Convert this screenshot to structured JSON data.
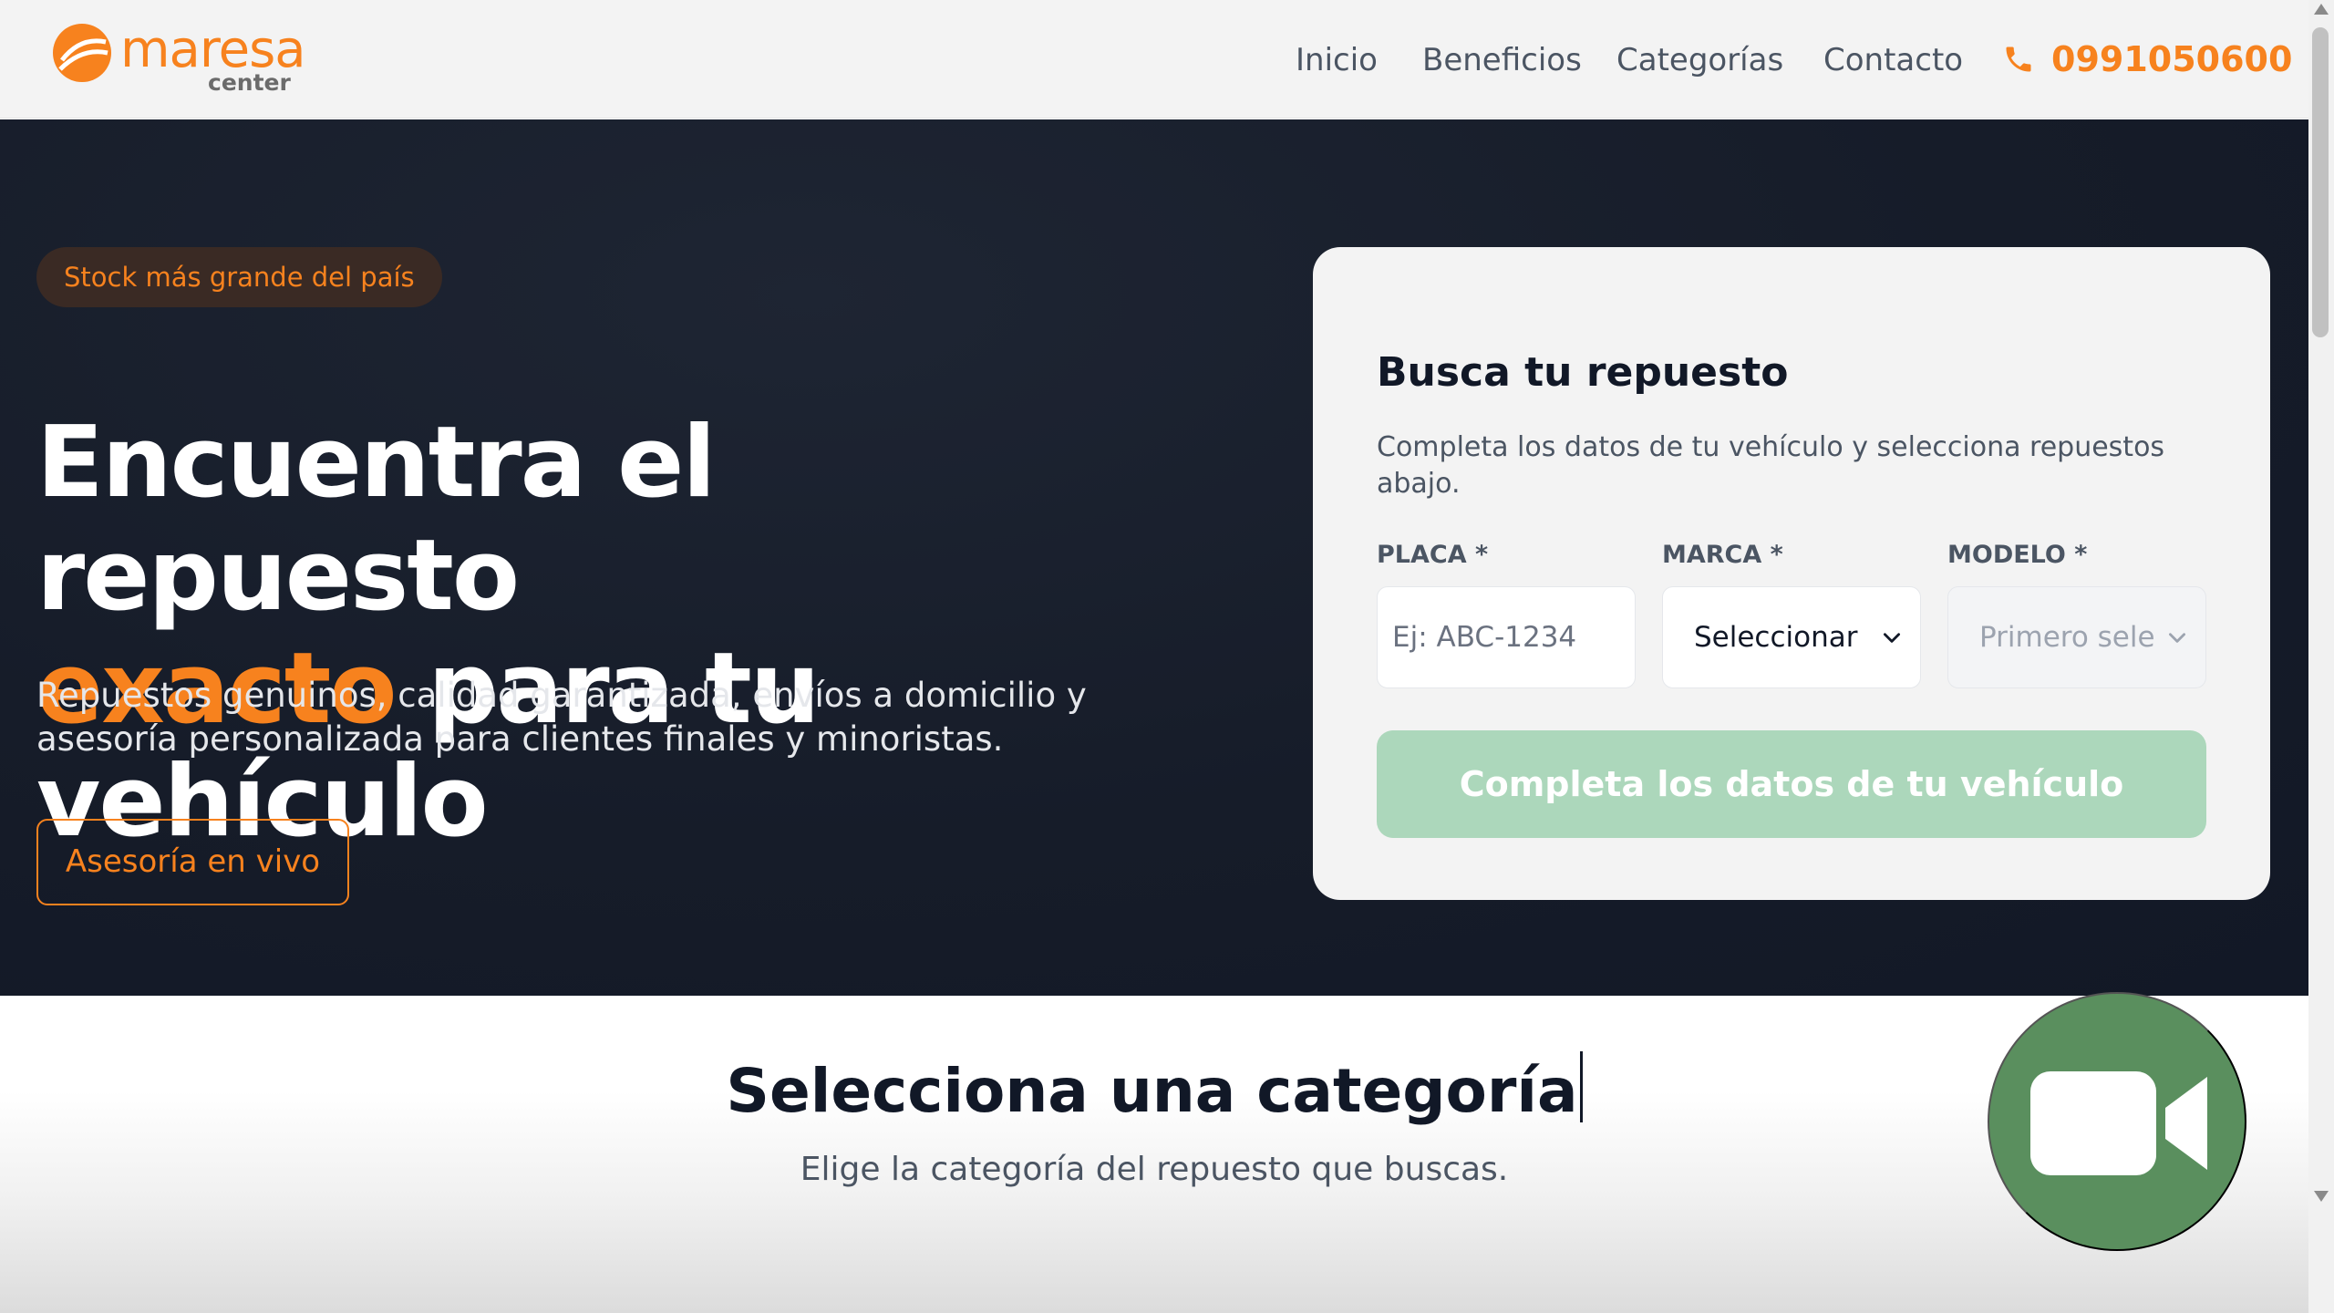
{
  "brand": {
    "name": "maresa",
    "sub": "center",
    "accent_color": "#f7821e"
  },
  "nav": {
    "items": [
      {
        "label": "Inicio"
      },
      {
        "label": "Beneficios"
      },
      {
        "label": "Categorías"
      },
      {
        "label": "Contacto"
      }
    ],
    "phone": "0991050600",
    "phone_icon": "phone-icon"
  },
  "hero": {
    "badge": "Stock más grande del país",
    "title_line1": "Encuentra el repuesto",
    "title_accent": "exacto",
    "title_line2_rest": " para tu vehículo",
    "description": "Repuestos genuinos, calidad garantizada, envíos a domicilio y asesoría personalizada para clientes finales y minoristas.",
    "cta_label": "Asesoría en vivo",
    "background_color": "#161c29"
  },
  "search_card": {
    "title": "Busca tu repuesto",
    "description": "Completa los datos de tu vehículo y selecciona repuestos abajo.",
    "placa_label": "PLACA *",
    "placa_placeholder": "Ej: ABC-1234",
    "marca_label": "MARCA *",
    "marca_value": "Seleccionar",
    "modelo_label": "MODELO *",
    "modelo_value": "Primero sele",
    "submit_label": "Completa los datos de tu vehículo",
    "submit_color": "#acd7bb"
  },
  "categories": {
    "title": "Selecciona una categoría",
    "subtitle": "Elige la categoría del repuesto que buscas."
  },
  "video_button": {
    "icon": "video-camera-icon",
    "color": "#5a8f5e"
  }
}
